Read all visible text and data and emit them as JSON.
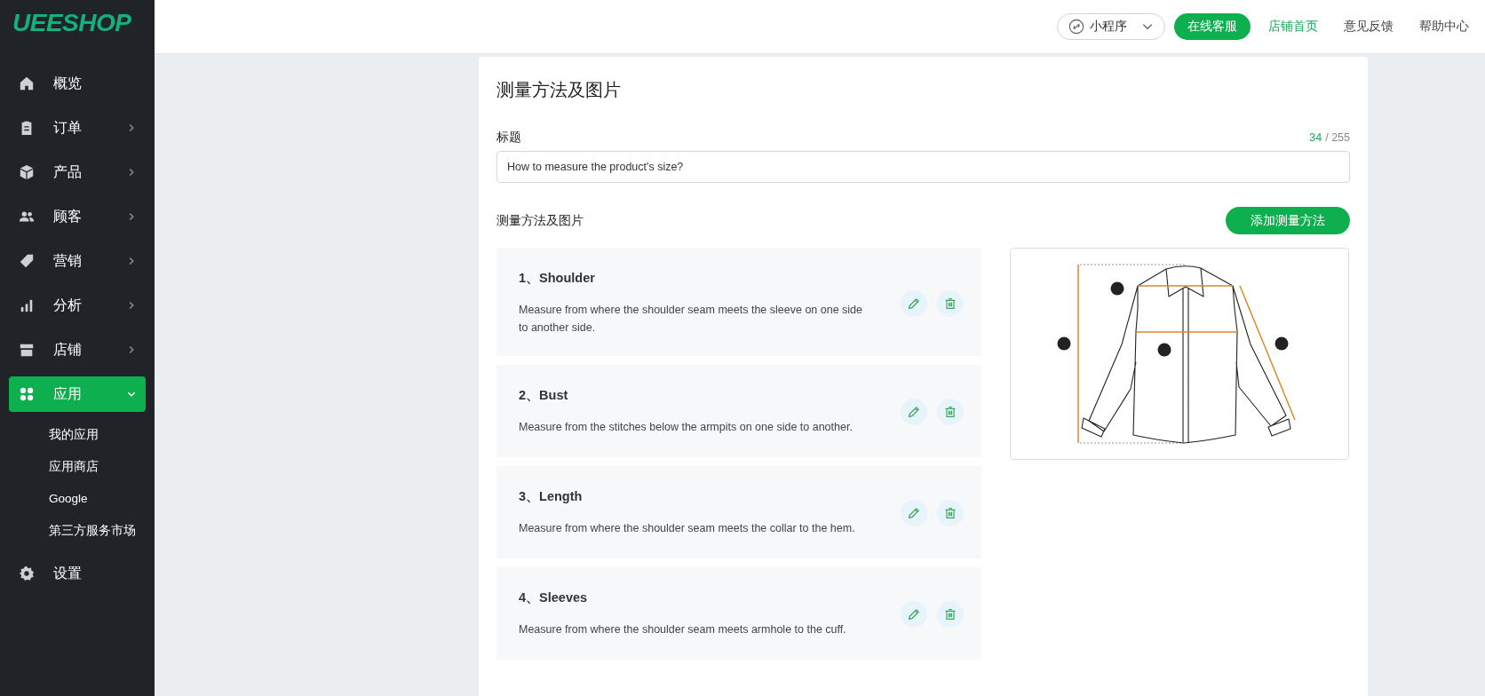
{
  "logo": {
    "text": "UEESHOP"
  },
  "sidebar": {
    "items": [
      {
        "label": "概览",
        "expandable": false,
        "selected": false
      },
      {
        "label": "订单",
        "expandable": true,
        "selected": false
      },
      {
        "label": "产品",
        "expandable": true,
        "selected": false
      },
      {
        "label": "顾客",
        "expandable": true,
        "selected": false
      },
      {
        "label": "营销",
        "expandable": true,
        "selected": false
      },
      {
        "label": "分析",
        "expandable": true,
        "selected": false
      },
      {
        "label": "店铺",
        "expandable": true,
        "selected": false
      },
      {
        "label": "应用",
        "expandable": true,
        "selected": true,
        "children": [
          {
            "label": "我的应用"
          },
          {
            "label": "应用商店"
          },
          {
            "label": "Google"
          },
          {
            "label": "第三方服务市场"
          }
        ]
      },
      {
        "label": "设置",
        "expandable": false,
        "selected": false
      }
    ]
  },
  "top_bar": {
    "mini_program": "小程序",
    "service_button": "在线客服",
    "links": [
      {
        "label": "店铺首页",
        "selected": true
      },
      {
        "label": "意见反馈",
        "selected": false
      },
      {
        "label": "帮助中心",
        "selected": false
      }
    ]
  },
  "card": {
    "title": "测量方法及图片",
    "title_field": {
      "label": "标题",
      "value": "How to measure the product's size?",
      "count": "34",
      "limit": "/ 255"
    },
    "methods_label": "测量方法及图片",
    "add_button": "添加测量方法",
    "methods": [
      {
        "name": "1、Shoulder",
        "description": "Measure from where the shoulder seam meets the sleeve on one side to another side."
      },
      {
        "name": "2、Bust",
        "description": "Measure from the stitches below the armpits on one side to another."
      },
      {
        "name": "3、Length",
        "description": "Measure from where the shoulder seam meets the collar to the hem."
      },
      {
        "name": "4、Sleeves",
        "description": "Measure from where the shoulder seam meets armhole to the cuff."
      }
    ]
  }
}
